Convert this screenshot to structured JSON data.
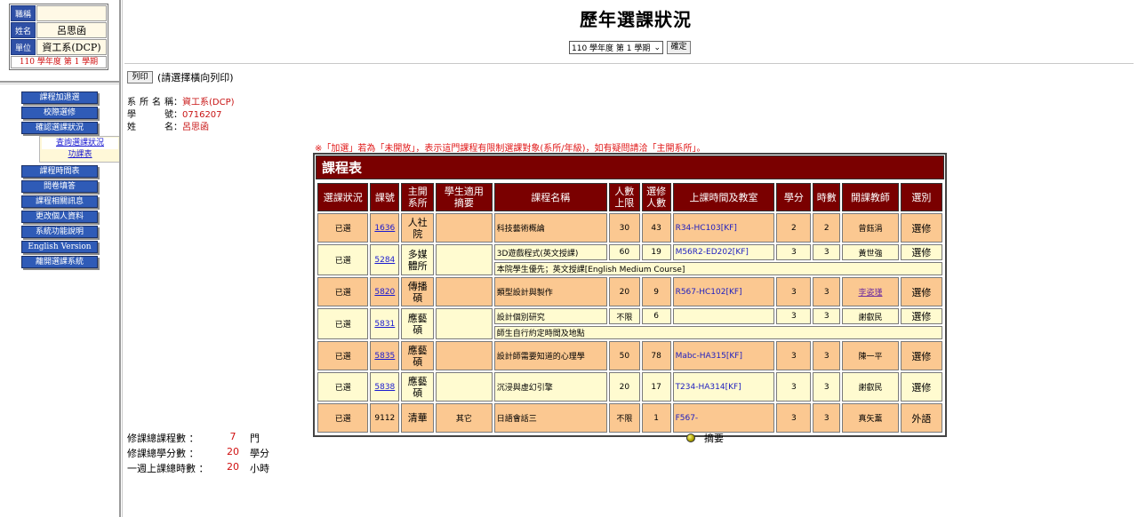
{
  "user": {
    "title_label": "職稱",
    "title_value": "",
    "name_label": "姓名",
    "name_value": "呂思函",
    "unit_label": "單位",
    "unit_value": "資工系(DCP)",
    "term": "110 學年度 第 1 學期"
  },
  "menu": {
    "items": [
      "課程加退選",
      "校際選修",
      "確認選課狀況",
      "課程時間表",
      "問卷填答",
      "課程相關訊息",
      "更改個人資料",
      "系統功能說明",
      "English Version",
      "離開選課系統"
    ],
    "sub_items": [
      "查詢選課狀況",
      "功課表"
    ]
  },
  "page": {
    "title": "歷年選課狀況",
    "term_select": "110 學年度 第 1 學期",
    "confirm_label": "確定",
    "print_label": "列印",
    "print_hint": "(請選擇橫向列印)"
  },
  "student": {
    "dept_label": "系所名稱",
    "dept_value": "資工系(DCP)",
    "id_label": "學號",
    "id_value": "0716207",
    "name_label": "姓名",
    "name_value": "呂思函"
  },
  "notice": "※「加選」若為「未開放」，表示這門課程有限制選課對象(系所/年級)，如有疑問請洽「主開系所」。",
  "course_table": {
    "title": "課程表",
    "headers": [
      "選課狀況",
      "課號",
      "主開系所",
      "學生適用摘要",
      "課程名稱",
      "人數上限",
      "選修人數",
      "上課時間及教室",
      "學分",
      "時數",
      "開課教師",
      "選別"
    ],
    "rows": [
      {
        "status": "已選",
        "code": "1636",
        "dept": "人社院",
        "summary": "",
        "name": "科技藝術概論",
        "limit": "30",
        "enrolled": "43",
        "time": "R34-HC103[KF]",
        "credits": "2",
        "hours": "2",
        "teacher": "曾鈺涓",
        "type": "選修",
        "note": ""
      },
      {
        "status": "已選",
        "code": "5284",
        "dept": "多媒體所",
        "summary": "",
        "name": "3D遊戲程式(英文授課)",
        "limit": "60",
        "enrolled": "19",
        "time": "M56R2-ED202[KF]",
        "credits": "3",
        "hours": "3",
        "teacher": "黃世強",
        "type": "選修",
        "note": "本院學生優先；英文授課[English Medium Course]"
      },
      {
        "status": "已選",
        "code": "5820",
        "dept": "傳播碩",
        "summary": "",
        "name": "類型設計與製作",
        "limit": "20",
        "enrolled": "9",
        "time": "R567-HC102[KF]",
        "credits": "3",
        "hours": "3",
        "teacher": "李姿瑾",
        "type": "選修",
        "note": ""
      },
      {
        "status": "已選",
        "code": "5831",
        "dept": "應藝碩",
        "summary": "",
        "name": "設計個別研究",
        "limit": "不限",
        "enrolled": "6",
        "time": "",
        "credits": "3",
        "hours": "3",
        "teacher": "謝叡民",
        "type": "選修",
        "note": "師生自行約定時間及地點"
      },
      {
        "status": "已選",
        "code": "5835",
        "dept": "應藝碩",
        "summary": "",
        "name": "設計師需要知道的心理學",
        "limit": "50",
        "enrolled": "78",
        "time": "Mabc-HA315[KF]",
        "credits": "3",
        "hours": "3",
        "teacher": "陳一平",
        "type": "選修",
        "note": ""
      },
      {
        "status": "已選",
        "code": "5838",
        "dept": "應藝碩",
        "summary": "",
        "name": "沉浸與虛幻引擎",
        "limit": "20",
        "enrolled": "17",
        "time": "T234-HA314[KF]",
        "credits": "3",
        "hours": "3",
        "teacher": "謝叡民",
        "type": "選修",
        "note": ""
      },
      {
        "status": "已選",
        "code": "9112",
        "dept": "清華",
        "summary": "其它",
        "name": "日語會話三",
        "limit": "不限",
        "enrolled": "1",
        "time": "F567-",
        "credits": "3",
        "hours": "3",
        "teacher": "真矢薰",
        "type": "外語",
        "note": ""
      }
    ]
  },
  "legend": {
    "summary_label": "摘要"
  },
  "totals": {
    "courses_label": "修課總課程數 ：",
    "courses_value": "7",
    "courses_unit": "門",
    "credits_label": "修課總學分數 ：",
    "credits_value": "20",
    "credits_unit": "學分",
    "hours_label": "一週上課總時數 ：",
    "hours_value": "20",
    "hours_unit": "小時"
  },
  "colors": {
    "header_bg": "#7a0000",
    "row_orange": "#fbc891",
    "row_yellow": "#fffbd0",
    "menu_blue": "#2f5bb7",
    "alert_red": "#e01818"
  }
}
